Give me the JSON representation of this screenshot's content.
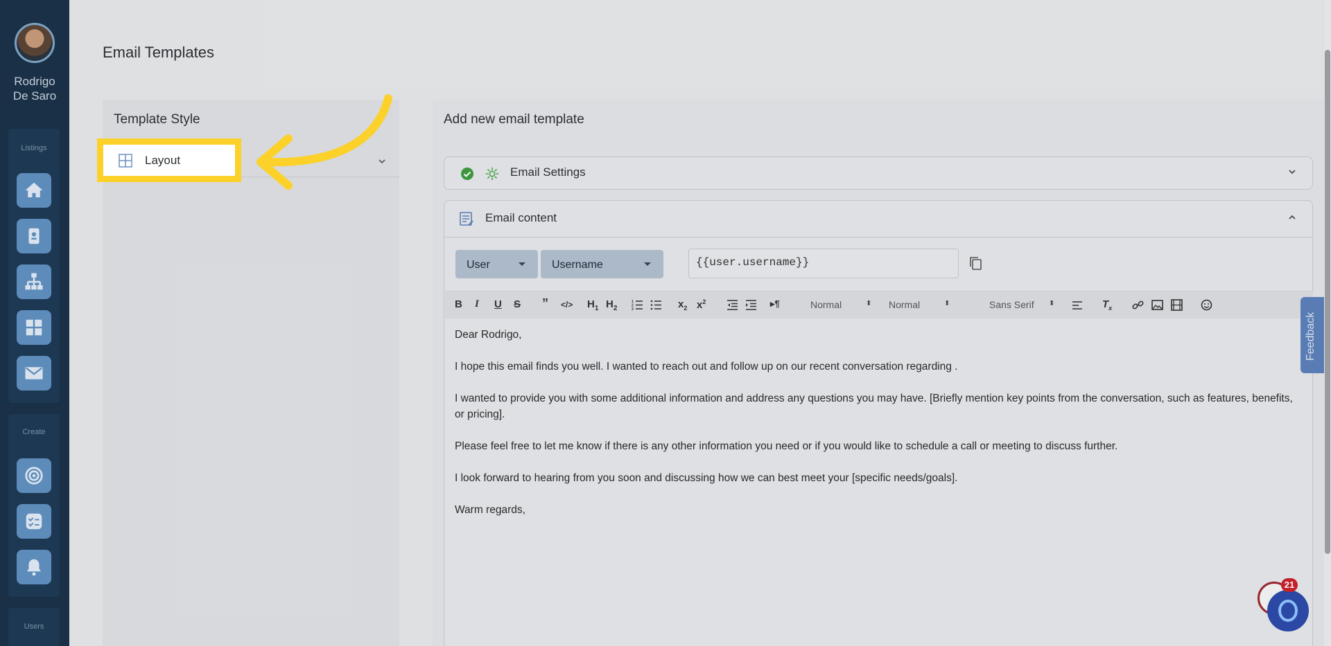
{
  "user": {
    "name_line1": "Rodrigo",
    "name_line2": "De Saro"
  },
  "sidebar": {
    "sections": [
      {
        "label": "Listings"
      },
      {
        "label": "Create"
      },
      {
        "label": "Users"
      }
    ],
    "listing_icons": [
      "home-icon",
      "contact-card-icon",
      "org-chart-icon",
      "grid-icon",
      "envelope-icon"
    ],
    "create_icons": [
      "target-icon",
      "checklist-icon",
      "bell-icon"
    ]
  },
  "page": {
    "title": "Email Templates"
  },
  "template_style": {
    "title": "Template Style",
    "layout_label": "Layout"
  },
  "new_template": {
    "title": "Add new email template",
    "email_settings_label": "Email Settings",
    "email_content_label": "Email content",
    "var_group_select": "User",
    "var_field_select": "Username",
    "var_token": "{{user.username}}"
  },
  "toolbar": {
    "header_select": "Normal",
    "size_select": "Normal",
    "font_select": "Sans Serif",
    "h1": "H",
    "h2": "H"
  },
  "editor": {
    "paragraphs": [
      "Dear Rodrigo,",
      "I hope this email finds you well. I wanted to reach out and follow up on our recent conversation regarding .",
      "I wanted to provide you with some additional information and address any questions you may have. [Briefly mention key points from the conversation, such as features, benefits, or pricing].",
      "Please feel free to let me know if there is any other information you need or if you would like to schedule a call or meeting to discuss further.",
      "I look forward to hearing from you soon and discussing how we can best meet your [specific needs/goals].",
      "Warm regards,"
    ]
  },
  "feedback_label": "Feedback",
  "chat_badge": "21",
  "colors": {
    "highlight": "#fcd12a",
    "sidebar": "#1a3148",
    "nav_button": "#5f8fbf",
    "feedback": "#5b7fb8"
  }
}
